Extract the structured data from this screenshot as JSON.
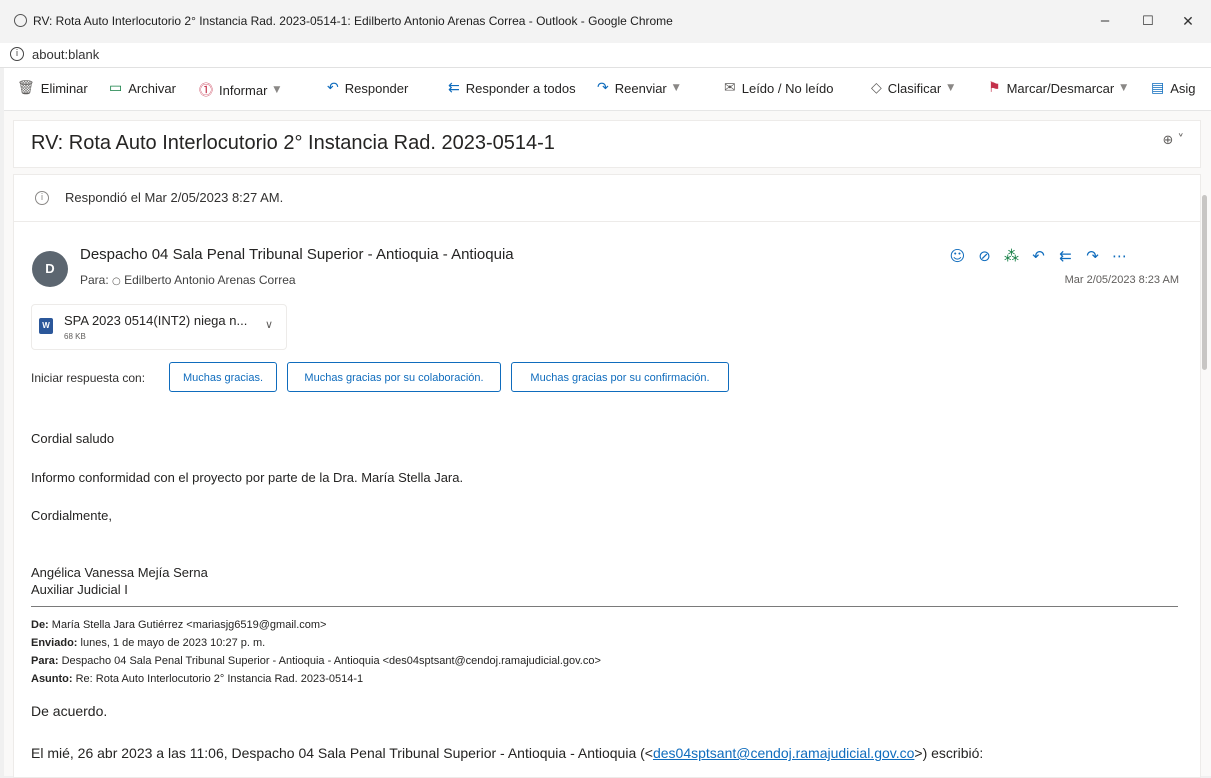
{
  "window": {
    "title": "RV: Rota Auto Interlocutorio 2° Instancia Rad. 2023-0514-1: Edilberto Antonio Arenas Correa - Outlook - Google Chrome",
    "minimize": "–",
    "maximize": "☐",
    "close": "✕"
  },
  "address_bar": {
    "url": "about:blank"
  },
  "toolbar": {
    "eliminar": "Eliminar",
    "archivar": "Archivar",
    "informar": "Informar",
    "responder": "Responder",
    "responder_todos": "Responder a todos",
    "reenviar": "Reenviar",
    "leido": "Leído / No leído",
    "clasificar": "Clasificar",
    "marcar": "Marcar/Desmarcar",
    "asignar": "Asig"
  },
  "subject": "RV: Rota Auto Interlocutorio 2° Instancia Rad. 2023-0514-1",
  "info_bar": "Respondió el Mar 2/05/2023 8:27 AM.",
  "message": {
    "avatar_initial": "D",
    "sender": "Despacho 04 Sala Penal Tribunal Superior - Antioquia - Antioquia",
    "to_label": "Para:",
    "to": "Edilberto Antonio Arenas Correa",
    "date": "Mar 2/05/2023 8:23 AM"
  },
  "attachment": {
    "name": "SPA 2023 0514(INT2) niega n...",
    "size": "68 KB"
  },
  "quick_reply": {
    "label": "Iniciar respuesta con:",
    "options": [
      "Muchas gracias.",
      "Muchas gracias por su colaboración.",
      "Muchas gracias por su confirmación."
    ]
  },
  "body": {
    "greeting": "Cordial saludo",
    "line1": "Informo conformidad con el proyecto por parte de la Dra. María Stella Jara.",
    "closing": "Cordialmente,",
    "sig_name": "Angélica Vanessa Mejía Serna",
    "sig_title": "Auxiliar Judicial I"
  },
  "forwarded": {
    "de_label": "De:",
    "de": "María Stella Jara Gutiérrez <mariasjg6519@gmail.com>",
    "enviado_label": "Enviado:",
    "enviado": "lunes, 1 de mayo de 2023 10:27 p. m.",
    "para_label": "Para:",
    "para": "Despacho 04 Sala Penal Tribunal Superior - Antioquia - Antioquia <des04sptsant@cendoj.ramajudicial.gov.co>",
    "asunto_label": "Asunto:",
    "asunto": "Re: Rota Auto Interlocutorio 2° Instancia Rad. 2023-0514-1",
    "reply": "De acuerdo.",
    "quote_prefix": "El mié, 26 abr 2023 a las 11:06, Despacho 04 Sala Penal Tribunal Superior - Antioquia - Antioquia (<",
    "quote_link": "des04sptsant@cendoj.ramajudicial.gov.co",
    "quote_suffix": ">) escribió:"
  },
  "colors": {
    "accent": "#0f6cbd",
    "danger": "#c4314b",
    "avatar": "#5c6670"
  },
  "icons": [
    "globe-icon",
    "info-icon",
    "trash-icon",
    "archive-icon",
    "report-icon",
    "reply-icon",
    "reply-all-icon",
    "forward-icon",
    "envelope-open-icon",
    "tag-icon",
    "flag-icon",
    "assign-icon",
    "zoom-icon",
    "emoji-icon",
    "tag-outline-icon",
    "apps-icon",
    "more-icon",
    "word-file-icon",
    "chevron-down-icon"
  ]
}
